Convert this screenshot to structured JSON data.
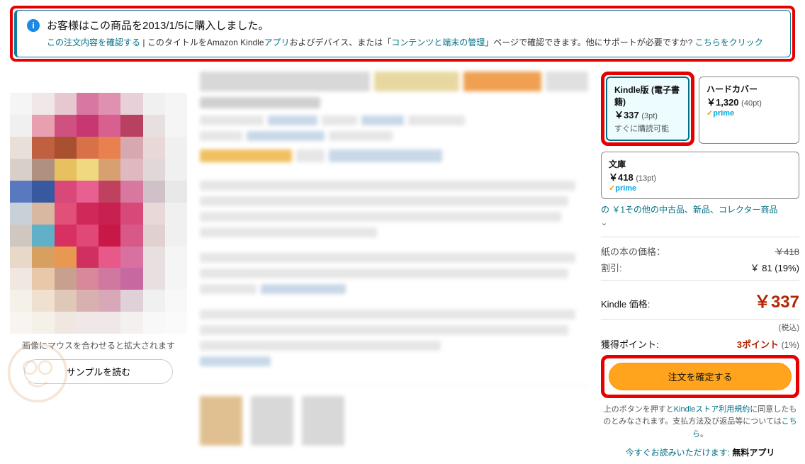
{
  "banner": {
    "title": "お客様はこの商品を2013/1/5に購入しました。",
    "link_order": "この注文内容を確認する",
    "sep": " | ",
    "mid1": "このタイトルをAmazon Kindle",
    "link_app": "アプリ",
    "mid2": "およびデバイス、または「",
    "link_manage": "コンテンツと端末の管理",
    "mid3": "」ページで確認できます。他にサポートが必要ですか? ",
    "link_help": "こちらをクリック"
  },
  "left": {
    "image_hint": "画像にマウスを合わせると拡大されます",
    "sample_button": "サンプルを読む"
  },
  "formats": {
    "kindle": {
      "title": "Kindle版 (電子書籍)",
      "price": "￥337",
      "points": "(3pt)",
      "avail": "すぐに購読可能"
    },
    "hardcover": {
      "title": "ハードカバー",
      "price": "￥1,320",
      "points": "(40pt)"
    },
    "bunko": {
      "title": "文庫",
      "price": "￥418",
      "points": "(13pt)"
    },
    "prime": "prime"
  },
  "other_link": {
    "prefix": "の ",
    "text": "￥1その他の中古品、新品、コレクター商品"
  },
  "pricing": {
    "paper_label": "紙の本の価格：",
    "paper_price": "￥418",
    "discount_label": "割引:",
    "discount_val": "￥ 81 (19%)",
    "kindle_label": "Kindle 価格:",
    "kindle_price": "￥337",
    "tax": "(税込)",
    "points_label": "獲得ポイント:",
    "points_val": "3ポイント",
    "points_pct": "(1%)"
  },
  "order": {
    "button": "注文を確定する",
    "terms1": "上のボタンを押すと",
    "terms_link1": "Kindleストア利用規約",
    "terms2": "に同意したものとみなされます。支払方法及び返品等については",
    "terms_link2": "こちら",
    "terms3": "。",
    "free_app_pre": "今すぐお読みいただけます: ",
    "free_app_bold": "無料アプリ"
  }
}
